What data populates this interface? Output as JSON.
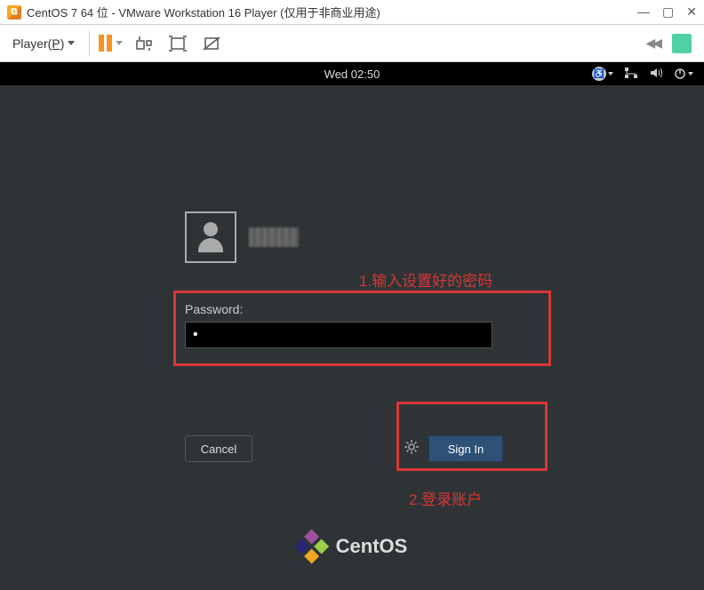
{
  "window": {
    "title": "CentOS 7 64 位 - VMware Workstation 16 Player (仅用于非商业用途)"
  },
  "toolbar": {
    "player_menu_prefix": "Player(",
    "player_menu_key": "P",
    "player_menu_suffix": ")"
  },
  "gnome": {
    "clock": "Wed 02:50"
  },
  "login": {
    "password_label": "Password:",
    "password_value": "•",
    "cancel_label": "Cancel",
    "signin_label": "Sign In"
  },
  "logo": {
    "text": "CentOS"
  },
  "annotations": {
    "step1": "1.输入设置好的密码",
    "step2": "2.登录账户"
  }
}
